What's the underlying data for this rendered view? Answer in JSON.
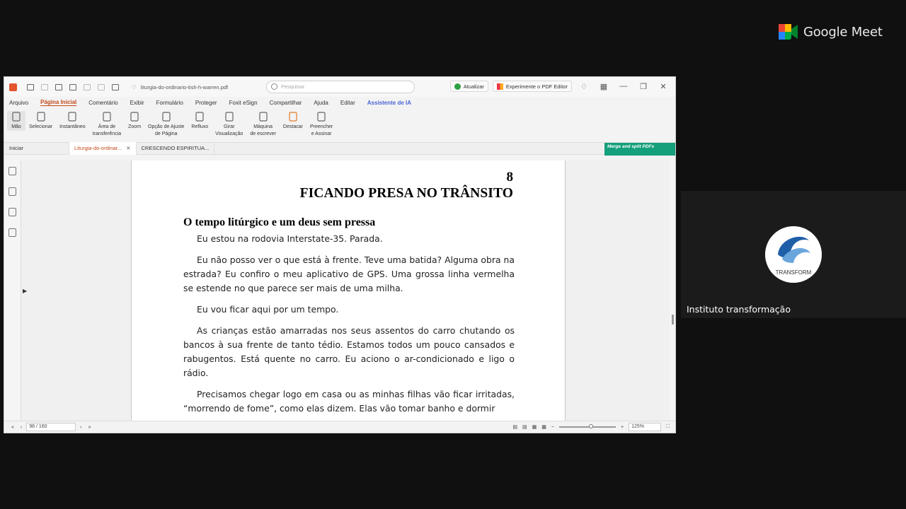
{
  "meet": {
    "brand": "Google Meet",
    "participant_name": "Instituto transformação",
    "avatar_text": "TRANSFORM"
  },
  "app": {
    "filename": "liturgia-do-ordinario-tish-h-warren.pdf",
    "search_placeholder": "Pesquisar",
    "update_label": "Atualizar",
    "try_editor_label": "Experimente o PDF Editor",
    "menu": [
      "Arquivo",
      "Página Inicial",
      "Comentário",
      "Exibir",
      "Formulário",
      "Proteger",
      "Foxit eSign",
      "Compartilhar",
      "Ajuda",
      "Editar",
      "Assistente de IA"
    ],
    "ribbon": [
      {
        "label": "Mão",
        "icon": "hand-icon"
      },
      {
        "label": "Selecionar",
        "icon": "select-text-icon"
      },
      {
        "label": "Instantâneo",
        "icon": "snapshot-icon"
      },
      {
        "label": "Área de\ntransferência",
        "icon": "clipboard-icon"
      },
      {
        "label": "Zoom",
        "icon": "zoom-icon"
      },
      {
        "label": "Opção de Ajuste\nde Página",
        "icon": "fit-page-icon"
      },
      {
        "label": "Refluxo",
        "icon": "reflow-icon"
      },
      {
        "label": "Girar\nVisualização",
        "icon": "rotate-icon"
      },
      {
        "label": "Máquina\nde escrever",
        "icon": "typewriter-icon"
      },
      {
        "label": "Destacar",
        "icon": "highlight-icon"
      },
      {
        "label": "Preencher\ne Assinar",
        "icon": "fill-sign-icon"
      }
    ],
    "tabs": {
      "home": "Iniciar",
      "current": "Liturgia-do-ordinar...",
      "other": "CRESCENDO ESPIRITUA..."
    },
    "merge_banner": "Merge and split PDFs",
    "page_indicator": "98 / 160",
    "zoom": "125%"
  },
  "document": {
    "chapter_number": "8",
    "chapter_title": "FICANDO PRESA NO TRÂNSITO",
    "section_title": "O tempo litúrgico e um deus sem pressa",
    "paragraphs": [
      "Eu estou na rodovia Interstate-35. Parada.",
      "Eu não posso ver o que está à frente. Teve uma batida? Alguma obra na estrada? Eu confiro o meu aplicativo de GPS. Uma grossa linha vermelha se estende no que parece ser mais de uma milha.",
      "Eu vou ficar aqui por um tempo.",
      "As crianças estão amarradas nos seus assentos do carro chutando os bancos à sua frente de tanto tédio. Estamos todos um pouco cansados e rabugentos. Está quente no carro. Eu aciono o ar-condicionado e ligo o rádio.",
      "Precisamos chegar logo em casa ou as minhas filhas vão ficar irritadas, “morrendo de fome”, como elas dizem. Elas vão tomar banho e dormir"
    ]
  }
}
